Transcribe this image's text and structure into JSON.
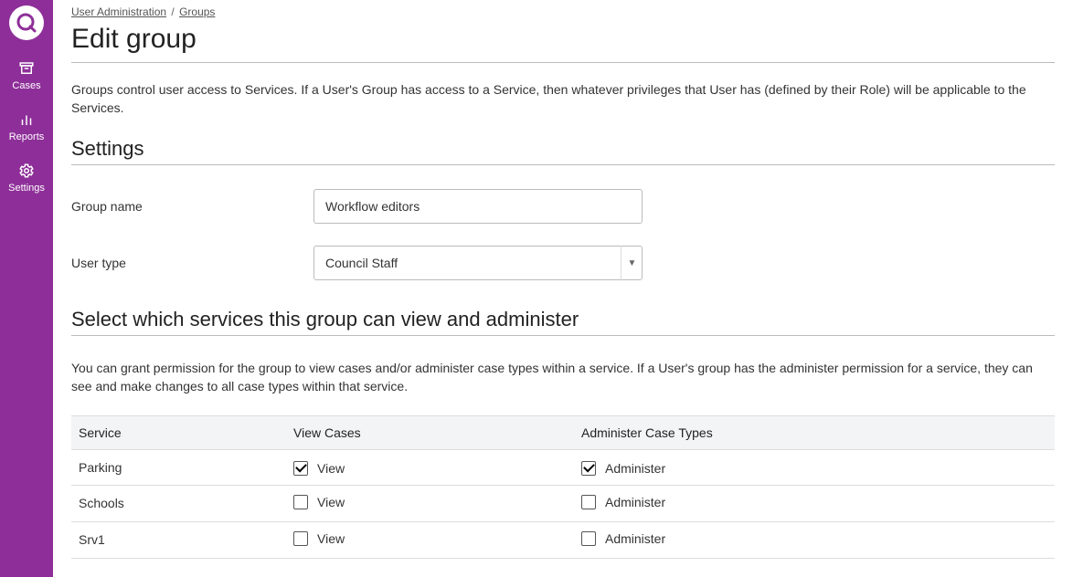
{
  "sidebar": {
    "items": [
      {
        "key": "cases",
        "label": "Cases"
      },
      {
        "key": "reports",
        "label": "Reports"
      },
      {
        "key": "settings",
        "label": "Settings"
      }
    ]
  },
  "breadcrumb": {
    "parent": "User Administration",
    "current": "Groups"
  },
  "page": {
    "title": "Edit group",
    "description": "Groups control user access to Services. If a User's Group has access to a Service, then whatever privileges that User has (defined by their Role) will be applicable to the Services."
  },
  "settings": {
    "heading": "Settings",
    "group_name_label": "Group name",
    "group_name_value": "Workflow editors",
    "user_type_label": "User type",
    "user_type_value": "Council Staff"
  },
  "services": {
    "heading": "Select which services this group can view and administer",
    "description": "You can grant permission for the group to view cases and/or administer case types within a service. If a User's group has the administer permission for a service, they can see and make changes to all case types within that service.",
    "columns": {
      "service": "Service",
      "view": "View Cases",
      "admin": "Administer Case Types"
    },
    "view_label": "View",
    "admin_label": "Administer",
    "rows": [
      {
        "name": "Parking",
        "view": true,
        "admin": true
      },
      {
        "name": "Schools",
        "view": false,
        "admin": false
      },
      {
        "name": "Srv1",
        "view": false,
        "admin": false
      }
    ]
  }
}
